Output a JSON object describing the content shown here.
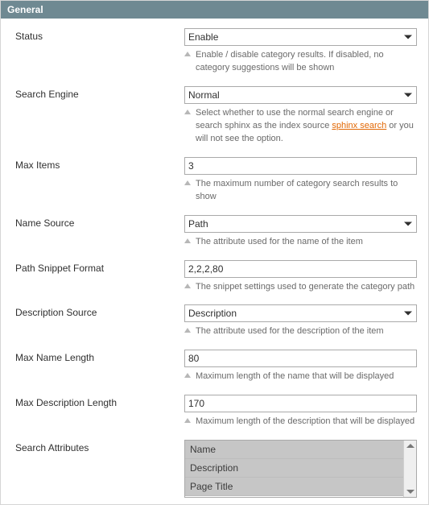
{
  "panel_title": "General",
  "fields": {
    "status": {
      "label": "Status",
      "value": "Enable",
      "hint": "Enable / disable category results. If disabled, no category suggestions will be shown"
    },
    "search_engine": {
      "label": "Search Engine",
      "value": "Normal",
      "hint_pre": "Select whether to use the normal search engine or search sphinx as the index source ",
      "hint_link": "sphinx search",
      "hint_post": " or you will not see the option."
    },
    "max_items": {
      "label": "Max Items",
      "value": "3",
      "hint": "The maximum number of category search results to show"
    },
    "name_source": {
      "label": "Name Source",
      "value": "Path",
      "hint": "The attribute used for the name of the item"
    },
    "path_snippet": {
      "label": "Path Snippet Format",
      "value": "2,2,2,80",
      "hint": "The snippet settings used to generate the category path"
    },
    "description_source": {
      "label": "Description Source",
      "value": "Description",
      "hint": "The attribute used for the description of the item"
    },
    "max_name_length": {
      "label": "Max Name Length",
      "value": "80",
      "hint": "Maximum length of the name that will be displayed"
    },
    "max_description_length": {
      "label": "Max Description Length",
      "value": "170",
      "hint": "Maximum length of the description that will be displayed"
    },
    "search_attributes": {
      "label": "Search Attributes",
      "options": [
        "Name",
        "Description",
        "Page Title"
      ]
    }
  }
}
